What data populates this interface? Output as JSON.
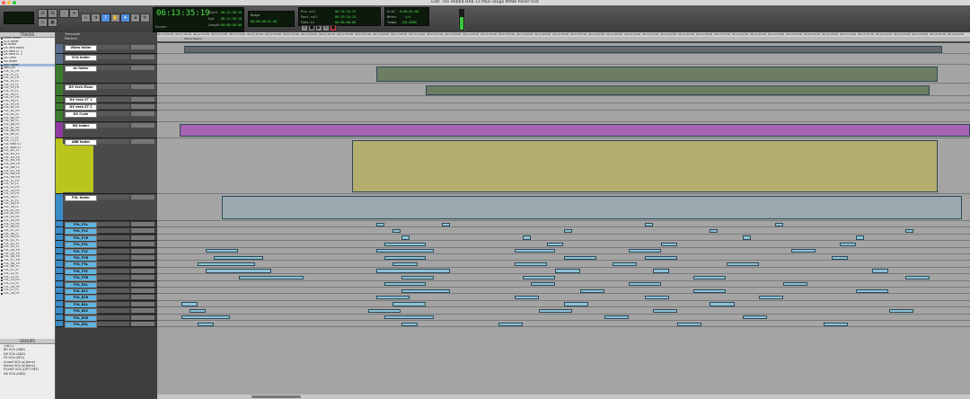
{
  "window": {
    "title": "Edit: The Hobbit HAB 13 Main Stage MPBK folder test"
  },
  "transport": {
    "main_counter": "06:13:35:19",
    "cursor_label": "Cursor",
    "start_label": "Start",
    "end_label": "End",
    "length_label": "Length",
    "start_value": "06:12:58:16",
    "end_value": "06:12:58:16",
    "length_value": "00:00:00:00",
    "nudge_label": "Nudge",
    "nudge_value": "00:00:00:01.00",
    "pre_roll_label": "Pre-roll",
    "post_roll_label": "Post-roll",
    "fade_in_label": "Fade-in",
    "pre_roll_value": "06:13:34:23",
    "post_roll_value": "06:13:34:23",
    "fade_in_value": "00:00:00:00",
    "grid_label": "Grid",
    "grid_value": "0:00:01:00",
    "meter_label": "Meter",
    "tempo_label": "Tempo",
    "meter_value": "4/4",
    "tempo_value": "120.0000"
  },
  "sidebar": {
    "tracks_header": "TRACKS",
    "groups_header": "GROUPS",
    "tracks": [
      "Video folder",
      "VCA folder",
      "dx folder",
      "DX Verb Mono",
      "DX Verb ST 1",
      "DX Verb ST 2",
      "DX Crain",
      "MX folder",
      "ABB folder",
      "ABB_DX",
      "FOL_P1_FR",
      "FOL_P1_FL",
      "FOL_P1_FR",
      "FOL_P2_FL",
      "FOL_P3_FL",
      "FOL_P4_FR",
      "FOL_P5_FL",
      "FOL_P6_FL",
      "FOL_P7_FR",
      "FOL_P8_FL",
      "FOL_P9_FR",
      "FOL_B1_FR",
      "FOL_B2_FR",
      "FOL_B3_FL",
      "FOL_B4_FR",
      "FOL_B5_FL",
      "FOL_B6_FR",
      "FOL_B7_FR",
      "FOL_B8_FR",
      "FOL_B9_FL",
      "FOL_T1_FL",
      "FOL_T2_FL",
      "FOL Verb ST",
      "FOL Verb ST",
      "FOL_M1_FL",
      "FOL_M2_FL",
      "FOL_M3_FR",
      "FOL_M4_FR",
      "FOL_M5_FR",
      "FOL_M6_FL",
      "FOL_M7_FR",
      "FOL_M8_FR",
      "FOL_M9_FR",
      "FOL_S1_FR",
      "FOL_S2_FL",
      "FOL_S3_FR",
      "FOL_S4_FR",
      "FOL_S5_FR",
      "FOL_S6_FL",
      "FOL_S7_FL",
      "FOL_S8_FR",
      "FOL_S9_FL",
      "FOL_R1_FR",
      "FOL_R2_FR",
      "FOL_R3_FR",
      "FOL_R4_FR",
      "FOL_R5_FR",
      "FOL_R6_FR",
      "FOL_R7_FL",
      "FOL_R8_FL",
      "FOL_R9_FR",
      "FOL_Q1_FL",
      "FOL_Q2_FL",
      "FOL_Q3_FL",
      "FOL_Q4_FR",
      "FOL_Q5_FR",
      "FOL_Q6_FR",
      "FOL_Q7_FR",
      "FOL_Q8_FR",
      "FOL_Q9_FL",
      "FOL_Z1_FL",
      "FOL_Z2_FL",
      "FOL_Z3_FL",
      "FOL_Z4_FR",
      "FOL_Z5_FL",
      "FOL_Z6_FR",
      "FOL_Z7_FL",
      "FOL_Z8_FR"
    ],
    "selected_track_index": 8,
    "groups": [
      "<ALL>",
      "BG VCA (ABD)",
      "DX VCA (ADG)",
      "FX VCA (AFG)",
      "Crowd VCA (a)(farm)",
      "Stems VCA (d)(farm)",
      "FX-REF VCA (LEFT REF)",
      "DX VCA (ADD)"
    ]
  },
  "edit_window": {
    "timecode_label": "Timecode",
    "markers_label": "Markers",
    "marker_text": "Stems Stems",
    "ruler_ticks": [
      "06:12:00:00",
      "06:12:05:00",
      "06:12:10:00",
      "06:12:15:00",
      "06:12:20:00",
      "06:12:25:00",
      "06:12:30:00",
      "06:12:35:00",
      "06:12:40:00",
      "06:12:45:00",
      "06:12:50:00",
      "06:12:55:00",
      "06:13:00:00",
      "06:13:05:00",
      "06:13:10:00",
      "06:13:15:00",
      "06:13:20:00",
      "06:13:25:00",
      "06:13:30:00",
      "06:13:35:00",
      "06:13:40:00",
      "06:13:45:00",
      "06:13:50:00",
      "06:13:55:00",
      "06:14:00:00",
      "06:14:05:00",
      "06:14:10:00",
      "06:14:15:00",
      "06:14:20:00",
      "06:14:25:00",
      "06:14:30:00",
      "06:14:35:00",
      "06:14:40:00",
      "06:14:45:00",
      "06:14:50:00",
      "06:14:55:00",
      "06:15:00:00",
      "06:15:05:00",
      "06:15:10:00",
      "06:15:15:00",
      "06:15:20:00",
      "06:15:25:00",
      "06:15:30:00",
      "06:15:35:00",
      "06:15:40:00"
    ]
  },
  "tracks": [
    {
      "name": "Video folder",
      "color": "#5a6e8c",
      "clips": [
        [
          0.033,
          0.966
        ]
      ],
      "clip_color": "#686868"
    },
    {
      "name": "VCA folder",
      "color": "#5a6e8c",
      "clips": [],
      "clip_color": "#7a7a7a"
    },
    {
      "name": "dx folder",
      "color": "#3c7a2c",
      "clips": [
        [
          0.27,
          0.96
        ]
      ],
      "clip_color": "#6d7d63"
    },
    {
      "name": "DX Verb Mono",
      "color": "#3c7a2c",
      "clips": [
        [
          0.33,
          0.95
        ]
      ],
      "clip_color": "#6d7d63"
    },
    {
      "name": "DX Verb ST 1",
      "color": "#3c7a2c",
      "clips": [],
      "clip_color": "#6d7d63"
    },
    {
      "name": "DX Verb ST 2",
      "color": "#3c7a2c",
      "clips": [],
      "clip_color": "#6d7d63"
    },
    {
      "name": "DX Crain",
      "color": "#3c7a2c",
      "clips": [],
      "clip_color": "#6d7d63"
    },
    {
      "name": "MX folder",
      "color": "#8e3aa0",
      "clips": [
        [
          0.028,
          1.0
        ]
      ],
      "clip_color": "#a764b3"
    },
    {
      "name": "ABB folder",
      "color": "#b9c41c",
      "clips": [
        [
          0.24,
          0.96
        ]
      ],
      "clip_color": "#b4ae6e"
    },
    {
      "name": "FOL folder",
      "color": "#3a8cc8",
      "clips": [
        [
          0.08,
          0.99
        ]
      ],
      "clip_color": "#9aa9b0"
    },
    {
      "name": "FOL_P1L",
      "color": "#3a8cc8",
      "clips": [
        [
          0.27,
          0.28
        ],
        [
          0.35,
          0.36
        ],
        [
          0.6,
          0.61
        ],
        [
          0.76,
          0.77
        ]
      ],
      "clip_color": "#8fc2d6"
    },
    {
      "name": "FOL_P1C",
      "color": "#3a8cc8",
      "clips": [
        [
          0.29,
          0.3
        ],
        [
          0.5,
          0.51
        ],
        [
          0.68,
          0.69
        ],
        [
          0.92,
          0.93
        ]
      ],
      "clip_color": "#8fc2d6"
    },
    {
      "name": "FOL_P1R",
      "color": "#3a8cc8",
      "clips": [
        [
          0.3,
          0.31
        ],
        [
          0.45,
          0.46
        ],
        [
          0.72,
          0.73
        ],
        [
          0.86,
          0.87
        ]
      ],
      "clip_color": "#8fc2d6"
    },
    {
      "name": "FOL_P2L",
      "color": "#3a8cc8",
      "clips": [
        [
          0.28,
          0.33
        ],
        [
          0.48,
          0.5
        ],
        [
          0.62,
          0.64
        ],
        [
          0.84,
          0.86
        ]
      ],
      "clip_color": "#8fc2d6"
    },
    {
      "name": "FOL_P2C",
      "color": "#3a8cc8",
      "clips": [
        [
          0.06,
          0.1
        ],
        [
          0.27,
          0.34
        ],
        [
          0.44,
          0.49
        ],
        [
          0.58,
          0.62
        ],
        [
          0.78,
          0.81
        ]
      ],
      "clip_color": "#8fc2d6"
    },
    {
      "name": "FOL_P2R",
      "color": "#3a8cc8",
      "clips": [
        [
          0.07,
          0.13
        ],
        [
          0.28,
          0.33
        ],
        [
          0.5,
          0.54
        ],
        [
          0.6,
          0.64
        ],
        [
          0.83,
          0.85
        ]
      ],
      "clip_color": "#8fc2d6"
    },
    {
      "name": "FOL_P3L",
      "color": "#3a8cc8",
      "clips": [
        [
          0.05,
          0.12
        ],
        [
          0.29,
          0.32
        ],
        [
          0.44,
          0.48
        ],
        [
          0.56,
          0.59
        ],
        [
          0.7,
          0.74
        ]
      ],
      "clip_color": "#8fc2d6"
    },
    {
      "name": "FOL_P3C",
      "color": "#3a8cc8",
      "clips": [
        [
          0.06,
          0.14
        ],
        [
          0.27,
          0.36
        ],
        [
          0.49,
          0.52
        ],
        [
          0.61,
          0.63
        ],
        [
          0.88,
          0.9
        ]
      ],
      "clip_color": "#8fc2d6"
    },
    {
      "name": "FOL_P3R",
      "color": "#3a8cc8",
      "clips": [
        [
          0.1,
          0.18
        ],
        [
          0.3,
          0.34
        ],
        [
          0.45,
          0.49
        ],
        [
          0.66,
          0.7
        ],
        [
          0.92,
          0.95
        ]
      ],
      "clip_color": "#8fc2d6"
    },
    {
      "name": "FOL_B1L",
      "color": "#3a8cc8",
      "clips": [
        [
          0.28,
          0.33
        ],
        [
          0.46,
          0.49
        ],
        [
          0.58,
          0.62
        ],
        [
          0.77,
          0.8
        ]
      ],
      "clip_color": "#8fc2d6"
    },
    {
      "name": "FOL_B1C",
      "color": "#3a8cc8",
      "clips": [
        [
          0.3,
          0.36
        ],
        [
          0.52,
          0.55
        ],
        [
          0.66,
          0.7
        ],
        [
          0.86,
          0.9
        ]
      ],
      "clip_color": "#8fc2d6"
    },
    {
      "name": "FOL_B1R",
      "color": "#3a8cc8",
      "clips": [
        [
          0.27,
          0.31
        ],
        [
          0.44,
          0.47
        ],
        [
          0.6,
          0.63
        ],
        [
          0.74,
          0.77
        ]
      ],
      "clip_color": "#8fc2d6"
    },
    {
      "name": "FOL_B2L",
      "color": "#3a8cc8",
      "clips": [
        [
          0.03,
          0.05
        ],
        [
          0.29,
          0.33
        ],
        [
          0.5,
          0.53
        ],
        [
          0.68,
          0.71
        ]
      ],
      "clip_color": "#8fc2d6"
    },
    {
      "name": "FOL_B2C",
      "color": "#3a8cc8",
      "clips": [
        [
          0.04,
          0.06
        ],
        [
          0.26,
          0.3
        ],
        [
          0.47,
          0.51
        ],
        [
          0.61,
          0.64
        ],
        [
          0.9,
          0.93
        ]
      ],
      "clip_color": "#8fc2d6"
    },
    {
      "name": "FOL_B2R",
      "color": "#3a8cc8",
      "clips": [
        [
          0.03,
          0.09
        ],
        [
          0.28,
          0.34
        ],
        [
          0.55,
          0.58
        ],
        [
          0.72,
          0.75
        ]
      ],
      "clip_color": "#8fc2d6"
    },
    {
      "name": "FOL_B3L",
      "color": "#3a8cc8",
      "clips": [
        [
          0.05,
          0.07
        ],
        [
          0.3,
          0.32
        ],
        [
          0.42,
          0.45
        ],
        [
          0.64,
          0.67
        ],
        [
          0.82,
          0.85
        ]
      ],
      "clip_color": "#8fc2d6"
    }
  ]
}
